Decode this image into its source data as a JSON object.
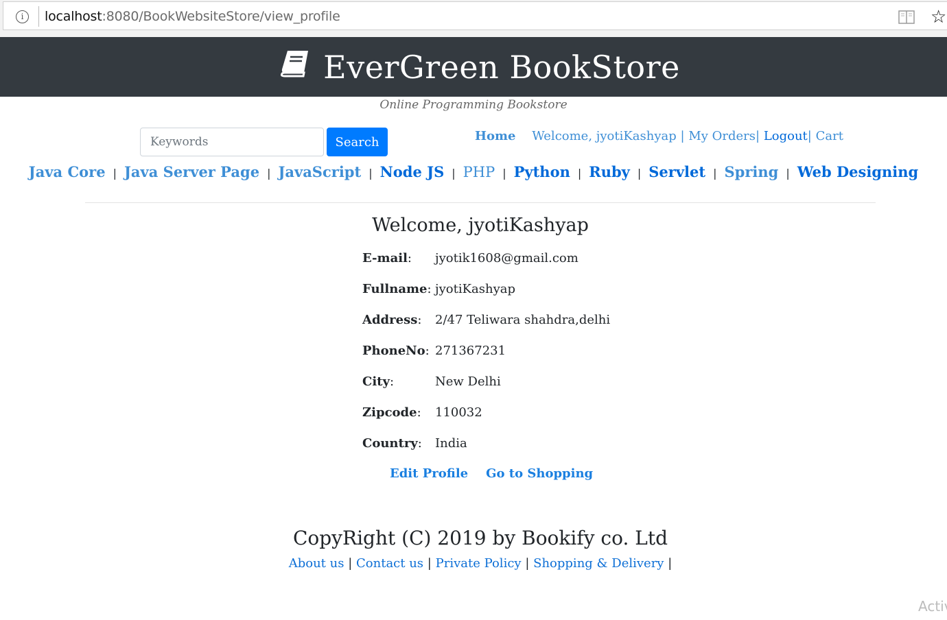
{
  "browser": {
    "url_host": "localhost",
    "url_path": ":8080/BookWebsiteStore/view_profile",
    "icons": {
      "info": "info-icon",
      "reader": "reader-view-icon",
      "favorite": "star-icon"
    }
  },
  "header": {
    "title": "EverGreen BookStore",
    "tagline": "Online Programming Bookstore",
    "logo_icon": "book-icon",
    "background": "#343a40"
  },
  "search": {
    "placeholder": "Keywords",
    "button_label": "Search"
  },
  "user_nav": {
    "home": "Home",
    "welcome": "Welcome, jyotiKashyap",
    "sep1": " | ",
    "orders": "My Orders",
    "sep2": "| ",
    "logout": "Logout",
    "sep3": "| ",
    "cart": "Cart"
  },
  "categories": [
    {
      "label": "Java Core"
    },
    {
      "label": "Java Server Page"
    },
    {
      "label": "JavaScript"
    },
    {
      "label": "Node JS"
    },
    {
      "label": "PHP"
    },
    {
      "label": "Python"
    },
    {
      "label": "Ruby"
    },
    {
      "label": "Servlet"
    },
    {
      "label": "Spring"
    },
    {
      "label": "Web Designing"
    }
  ],
  "category_separator": "|",
  "profile": {
    "welcome": "Welcome, jyotiKashyap",
    "fields": [
      {
        "label": "E-mail",
        "value": "jyotik1608@gmail.com"
      },
      {
        "label": "Fullname",
        "value": "jyotiKashyap"
      },
      {
        "label": "Address",
        "value": "2/47 Teliwara shahdra,delhi"
      },
      {
        "label": "PhoneNo",
        "value": "271367231"
      },
      {
        "label": "City",
        "value": "New Delhi"
      },
      {
        "label": "Zipcode",
        "value": "110032"
      },
      {
        "label": "Country",
        "value": "India"
      }
    ],
    "edit_label": "Edit Profile",
    "shopping_label": "Go to Shopping"
  },
  "footer": {
    "copyright": "CopyRight (C) 2019 by Bookify co. Ltd",
    "links": [
      {
        "label": "About us"
      },
      {
        "label": "Contact us"
      },
      {
        "label": "Private Policy"
      },
      {
        "label": "Shopping & Delivery"
      }
    ],
    "separator": "|"
  },
  "watermark": "Activ",
  "colors": {
    "primary": "#007bff",
    "link": "#3f8fd6",
    "link_dark": "#0069d9",
    "dark": "#343a40"
  }
}
